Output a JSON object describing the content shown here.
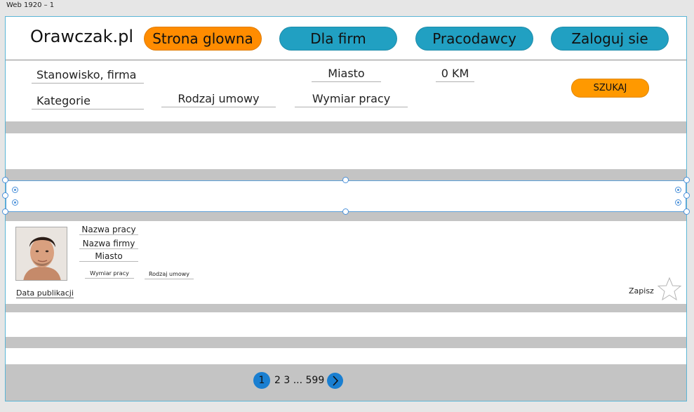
{
  "artboard_label": "Web 1920 – 1",
  "header": {
    "logo": "Orawczak.pl",
    "nav": [
      {
        "label": "Strona glowna"
      },
      {
        "label": "Dla firm"
      },
      {
        "label": "Pracodawcy"
      },
      {
        "label": "Zaloguj sie"
      }
    ]
  },
  "search": {
    "position_company": "Stanowisko, firma",
    "city": "Miasto",
    "distance": "0 KM",
    "category": "Kategorie",
    "contract_type": "Rodzaj umowy",
    "work_time": "Wymiar pracy",
    "submit": "SZUKAJ"
  },
  "job_card": {
    "job_name": "Nazwa pracy",
    "company_name": "Nazwa firmy",
    "city": "Miasto",
    "work_time": "Wymiar pracy",
    "contract_type": "Rodzaj umowy",
    "publish_date": "Data publikacji",
    "save": "Zapisz"
  },
  "pagination": {
    "current": "1",
    "others": "2 3 ... 599"
  },
  "colors": {
    "accent_orange": "#ff8c00",
    "nav_blue": "#21a0c2",
    "pagination_blue": "#1a7fd1",
    "selection_blue": "#4a90d9"
  },
  "icons": {
    "save": "star-icon",
    "next_page": "chevron-right-icon",
    "avatar": "person-photo"
  }
}
